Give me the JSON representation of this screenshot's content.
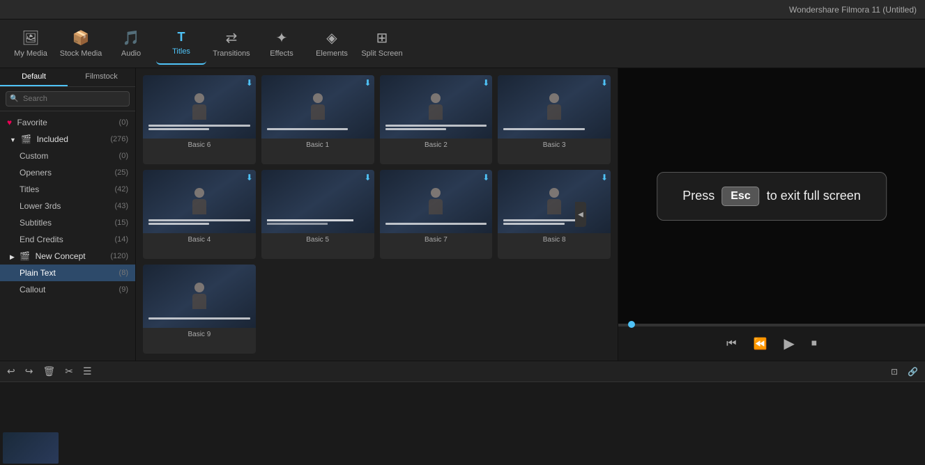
{
  "app": {
    "title": "Wondershare Filmora 11 (Untitled)"
  },
  "toolbar": {
    "items": [
      {
        "id": "my-media",
        "label": "My Media",
        "icon": "🖼"
      },
      {
        "id": "stock-media",
        "label": "Stock Media",
        "icon": "📦"
      },
      {
        "id": "audio",
        "label": "Audio",
        "icon": "🎵"
      },
      {
        "id": "titles",
        "label": "Titles",
        "icon": "T"
      },
      {
        "id": "transitions",
        "label": "Transitions",
        "icon": "⇄"
      },
      {
        "id": "effects",
        "label": "Effects",
        "icon": "✦"
      },
      {
        "id": "elements",
        "label": "Elements",
        "icon": "◈"
      },
      {
        "id": "split-screen",
        "label": "Split Screen",
        "icon": "⊞"
      }
    ]
  },
  "sidebar": {
    "tabs": [
      {
        "id": "default",
        "label": "Default"
      },
      {
        "id": "filmstock",
        "label": "Filmstock"
      }
    ],
    "search_placeholder": "Search",
    "favorite": {
      "label": "Favorite",
      "count": 0
    },
    "groups": [
      {
        "id": "included",
        "label": "Included",
        "count": 276,
        "expanded": true,
        "children": [
          {
            "id": "custom",
            "label": "Custom",
            "count": 0
          },
          {
            "id": "openers",
            "label": "Openers",
            "count": 25
          },
          {
            "id": "titles",
            "label": "Titles",
            "count": 42
          },
          {
            "id": "lower-3rds",
            "label": "Lower 3rds",
            "count": 43
          },
          {
            "id": "subtitles",
            "label": "Subtitles",
            "count": 15
          },
          {
            "id": "end-credits",
            "label": "End Credits",
            "count": 14
          }
        ]
      },
      {
        "id": "new-concept",
        "label": "New Concept",
        "count": 120,
        "expanded": false,
        "children": [
          {
            "id": "plain-text",
            "label": "Plain Text",
            "count": 8,
            "active": true
          },
          {
            "id": "callout",
            "label": "Callout",
            "count": 9
          }
        ]
      }
    ]
  },
  "grid": {
    "items": [
      {
        "id": "basic6",
        "label": "Basic 6"
      },
      {
        "id": "basic1",
        "label": "Basic 1"
      },
      {
        "id": "basic2",
        "label": "Basic 2"
      },
      {
        "id": "basic3",
        "label": "Basic 3"
      },
      {
        "id": "basic4",
        "label": "Basic 4"
      },
      {
        "id": "basic5",
        "label": "Basic 5"
      },
      {
        "id": "basic7",
        "label": "Basic 7"
      },
      {
        "id": "basic8",
        "label": "Basic 8"
      },
      {
        "id": "basic9",
        "label": "Basic 9"
      }
    ]
  },
  "esc_overlay": {
    "prefix": "Press",
    "key": "Esc",
    "suffix": "to exit full screen"
  },
  "preview": {
    "controls": {
      "prev_frame": "⏮",
      "rewind": "⏪",
      "play": "▶",
      "stop": "⏹"
    }
  },
  "bottom_toolbar": {
    "buttons": [
      "↩",
      "↪",
      "🗑",
      "✂",
      "☰"
    ]
  },
  "timeline": {
    "has_clip": true
  }
}
